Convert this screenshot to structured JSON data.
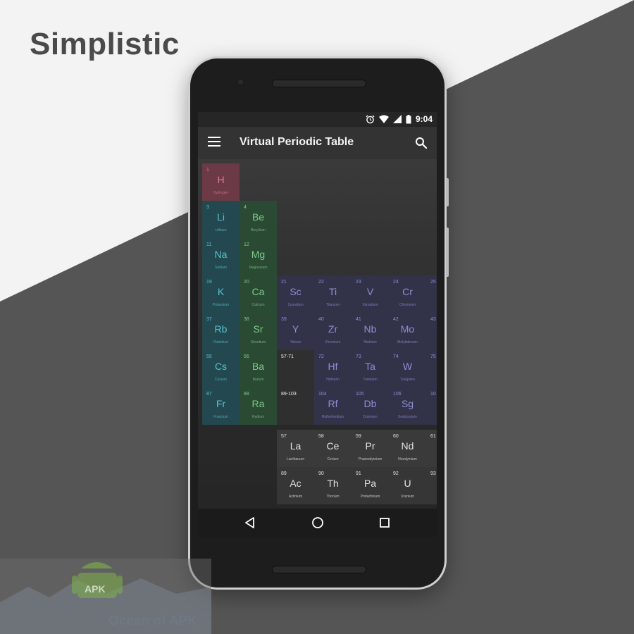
{
  "headline": "Simplistic",
  "status_bar": {
    "time": "9:04",
    "icons": [
      "alarm-icon",
      "wifi-icon",
      "signal-icon",
      "battery-icon"
    ]
  },
  "app_bar": {
    "title": "Virtual Periodic Table",
    "menu_icon": "menu-icon",
    "search_icon": "search-icon"
  },
  "elements": [
    {
      "num": "1",
      "sym": "H",
      "name": "Hydrogen",
      "group": "nonmetal"
    },
    {
      "num": "3",
      "sym": "Li",
      "name": "Lithium",
      "group": "alkali"
    },
    {
      "num": "4",
      "sym": "Be",
      "name": "Beryllium",
      "group": "alkaline"
    },
    {
      "num": "11",
      "sym": "Na",
      "name": "Sodium",
      "group": "alkali"
    },
    {
      "num": "12",
      "sym": "Mg",
      "name": "Magnesium",
      "group": "alkaline"
    },
    {
      "num": "19",
      "sym": "K",
      "name": "Potassium",
      "group": "alkali"
    },
    {
      "num": "20",
      "sym": "Ca",
      "name": "Calcium",
      "group": "alkaline"
    },
    {
      "num": "21",
      "sym": "Sc",
      "name": "Scandium",
      "group": "transition"
    },
    {
      "num": "22",
      "sym": "Ti",
      "name": "Titanium",
      "group": "transition"
    },
    {
      "num": "23",
      "sym": "V",
      "name": "Vanadium",
      "group": "transition"
    },
    {
      "num": "24",
      "sym": "Cr",
      "name": "Chromium",
      "group": "transition"
    },
    {
      "num": "25",
      "sym": "",
      "name": "",
      "group": "transition"
    },
    {
      "num": "37",
      "sym": "Rb",
      "name": "Rubidium",
      "group": "alkali"
    },
    {
      "num": "38",
      "sym": "Sr",
      "name": "Strontium",
      "group": "alkaline"
    },
    {
      "num": "39",
      "sym": "Y",
      "name": "Yttrium",
      "group": "transition"
    },
    {
      "num": "40",
      "sym": "Zr",
      "name": "Zirconium",
      "group": "transition"
    },
    {
      "num": "41",
      "sym": "Nb",
      "name": "Niobium",
      "group": "transition"
    },
    {
      "num": "42",
      "sym": "Mo",
      "name": "Molybdenum",
      "group": "transition"
    },
    {
      "num": "43",
      "sym": "",
      "name": "",
      "group": "transition"
    },
    {
      "num": "55",
      "sym": "Cs",
      "name": "Cesium",
      "group": "alkali"
    },
    {
      "num": "56",
      "sym": "Ba",
      "name": "Barium",
      "group": "alkaline"
    },
    {
      "num": "57-71",
      "sym": "",
      "name": "",
      "group": "placeholder"
    },
    {
      "num": "72",
      "sym": "Hf",
      "name": "Hafnium",
      "group": "transition"
    },
    {
      "num": "73",
      "sym": "Ta",
      "name": "Tantalum",
      "group": "transition"
    },
    {
      "num": "74",
      "sym": "W",
      "name": "Tungsten",
      "group": "transition"
    },
    {
      "num": "75",
      "sym": "",
      "name": "",
      "group": "transition"
    },
    {
      "num": "87",
      "sym": "Fr",
      "name": "Francium",
      "group": "alkali"
    },
    {
      "num": "88",
      "sym": "Ra",
      "name": "Radium",
      "group": "alkaline"
    },
    {
      "num": "89-103",
      "sym": "",
      "name": "",
      "group": "placeholder"
    },
    {
      "num": "104",
      "sym": "Rf",
      "name": "Rutherfordium",
      "group": "transition"
    },
    {
      "num": "105",
      "sym": "Db",
      "name": "Dubnium",
      "group": "transition"
    },
    {
      "num": "106",
      "sym": "Sg",
      "name": "Seaborgium",
      "group": "transition"
    },
    {
      "num": "10",
      "sym": "",
      "name": "",
      "group": "transition"
    },
    {
      "num": "57",
      "sym": "La",
      "name": "Lanthanum",
      "group": "lanthanide"
    },
    {
      "num": "58",
      "sym": "Ce",
      "name": "Cerium",
      "group": "lanthanide"
    },
    {
      "num": "59",
      "sym": "Pr",
      "name": "Praseodymium",
      "group": "lanthanide"
    },
    {
      "num": "60",
      "sym": "Nd",
      "name": "Neodymium",
      "group": "lanthanide"
    },
    {
      "num": "61",
      "sym": "",
      "name": "",
      "group": "lanthanide"
    },
    {
      "num": "89",
      "sym": "Ac",
      "name": "Actinium",
      "group": "actinide"
    },
    {
      "num": "90",
      "sym": "Th",
      "name": "Thorium",
      "group": "actinide"
    },
    {
      "num": "91",
      "sym": "Pa",
      "name": "Protactinium",
      "group": "actinide"
    },
    {
      "num": "92",
      "sym": "U",
      "name": "Uranium",
      "group": "actinide"
    },
    {
      "num": "93",
      "sym": "",
      "name": "",
      "group": "actinide"
    }
  ],
  "group_colors": {
    "nonmetal": {
      "bg": "#6b3a46",
      "fg": "#e07a8e"
    },
    "alkali": {
      "bg": "#24484f",
      "fg": "#56c2d2"
    },
    "alkaline": {
      "bg": "#2a4a33",
      "fg": "#7fc98a"
    },
    "transition": {
      "bg": "#323249",
      "fg": "#8f8fd6"
    },
    "placeholder": {
      "bg": "#2f2f2f",
      "fg": "#dddddd"
    },
    "lanthanide": {
      "bg": "#3a3a3a",
      "fg": "#e2e2e2"
    },
    "actinide": {
      "bg": "#363636",
      "fg": "#e2e2e2"
    }
  },
  "nav_bar": {
    "back": "back-icon",
    "home": "home-icon",
    "recents": "recents-icon"
  },
  "watermark": {
    "text": "Ocean of APK",
    "logo_label": "APK"
  }
}
